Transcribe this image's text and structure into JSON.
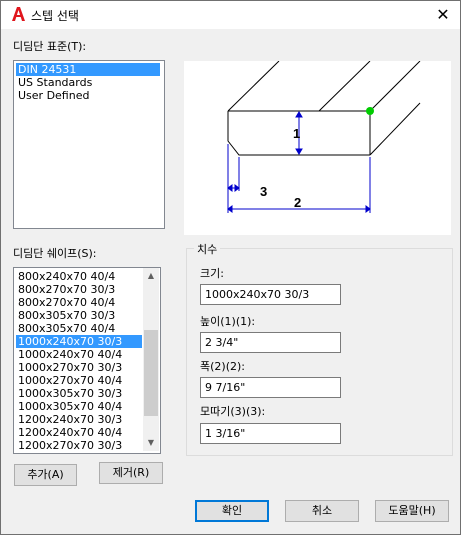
{
  "window": {
    "title": "스텝 선택",
    "close_label": "✕",
    "app_icon": "autocad-a-icon",
    "accent_color": "#0078d7",
    "selection_color": "#3399ff"
  },
  "standards": {
    "label": "디딤단 표준(T):",
    "items": [
      "DIN 24531",
      "US Standards",
      "User Defined"
    ],
    "selected_index": 0
  },
  "shapes": {
    "label": "디딤단 쉐이프(S):",
    "items": [
      "800x240x70 40/4",
      "800x270x70 30/3",
      "800x270x70 40/4",
      "800x305x70 30/3",
      "800x305x70 40/4",
      "1000x240x70 30/3",
      "1000x240x70 40/4",
      "1000x270x70 30/3",
      "1000x270x70 40/4",
      "1000x305x70 30/3",
      "1000x305x70 40/4",
      "1200x240x70 30/3",
      "1200x240x70 40/4",
      "1200x270x70 30/3"
    ],
    "selected_index": 5,
    "scroll_position": 0.5
  },
  "preview": {
    "labels": [
      "1",
      "2",
      "3"
    ],
    "line_color": "#000000",
    "dimension_color": "#0000cc",
    "grip_color": "#00cc00"
  },
  "dimensions": {
    "group_title": "치수",
    "size_label": "크기:",
    "size_value": "1000x240x70 30/3",
    "height_label": "높이(1)(1):",
    "height_value": "2 3/4\"",
    "width_label": "폭(2)(2):",
    "width_value": "9 7/16\"",
    "chamfer_label": "모따기(3)(3):",
    "chamfer_value": "1 3/16\""
  },
  "buttons": {
    "add": "추가(A)",
    "remove": "제거(R)",
    "ok": "확인",
    "cancel": "취소",
    "help": "도움말(H)"
  }
}
